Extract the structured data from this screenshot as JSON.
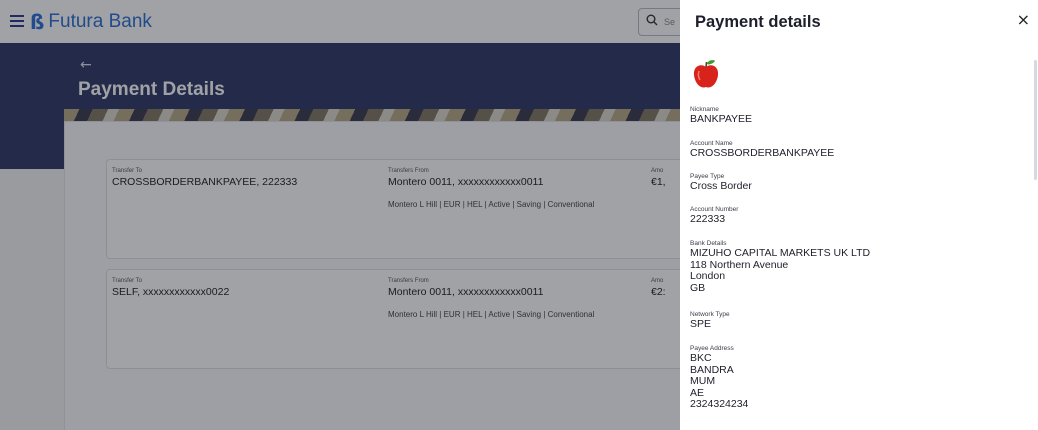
{
  "header": {
    "brand": "Futura Bank",
    "search_placeholder": "Se"
  },
  "page": {
    "back_label": "←",
    "title": "Payment Details"
  },
  "cards": [
    {
      "transfer_to_label": "Transfer To",
      "transfer_to_value": "CROSSBORDERBANKPAYEE, 222333",
      "transfers_from_label": "Transfers From",
      "transfers_from_value": "Montero 0011, xxxxxxxxxxxx0011",
      "transfers_from_details": "Montero L Hill | EUR | HEL | Active | Saving | Conventional",
      "amount_label": "Amo",
      "amount_value": "€1,"
    },
    {
      "transfer_to_label": "Transfer To",
      "transfer_to_value": "SELF, xxxxxxxxxxxx0022",
      "transfers_from_label": "Transfers From",
      "transfers_from_value": "Montero 0011, xxxxxxxxxxxx0011",
      "transfers_from_details": "Montero L Hill | EUR | HEL | Active | Saving | Conventional",
      "amount_label": "Amo",
      "amount_value": "€2:"
    }
  ],
  "panel": {
    "title": "Payment details",
    "close_label": "×",
    "avatar_icon": "apple-icon",
    "fields": [
      {
        "label": "Nickname",
        "value": "BANKPAYEE"
      },
      {
        "label": "Account Name",
        "value": "CROSSBORDERBANKPAYEE"
      },
      {
        "label": "Payee Type",
        "value": "Cross Border"
      },
      {
        "label": "Account Number",
        "value": "222333"
      },
      {
        "label": "Bank Details",
        "lines": [
          "MIZUHO CAPITAL MARKETS UK LTD",
          "118 Northern Avenue",
          "London",
          "GB"
        ]
      },
      {
        "label": "Network Type",
        "value": "SPE"
      },
      {
        "label": "Payee Address",
        "lines": [
          "BKC",
          "BANDRA",
          "MUM",
          "AE",
          "2324324234"
        ]
      }
    ]
  },
  "colors": {
    "brand": "#2a6fd6",
    "hero": "#2f3a68",
    "apple_red": "#d8231d",
    "apple_leaf": "#3a9b2e"
  }
}
